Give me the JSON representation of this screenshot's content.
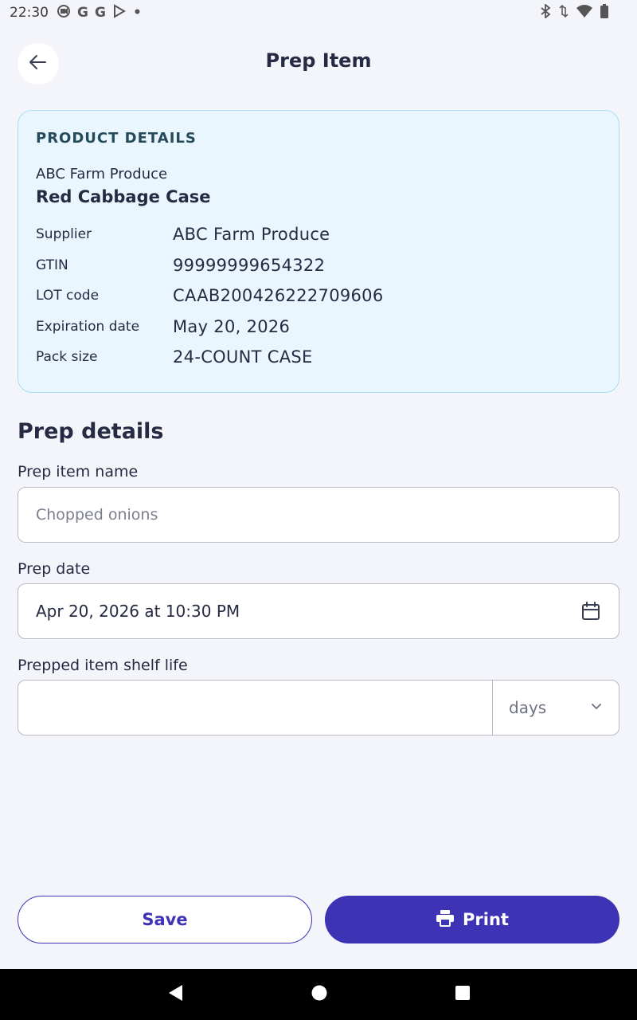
{
  "status_bar": {
    "time": "22:30",
    "left_icons": [
      "screen-record-icon",
      "google-icon",
      "google-icon",
      "play-store-icon",
      "dot-icon"
    ],
    "right_icons": [
      "bluetooth-icon",
      "data-arrows-icon",
      "wifi-icon",
      "battery-icon"
    ]
  },
  "header": {
    "title": "Prep Item",
    "back_icon": "arrow-left-icon"
  },
  "product_card": {
    "heading": "PRODUCT DETAILS",
    "supplier_top": "ABC Farm Produce",
    "product_name": "Red Cabbage Case",
    "details": [
      {
        "label": "Supplier",
        "value": "ABC Farm Produce"
      },
      {
        "label": "GTIN",
        "value": "99999999654322"
      },
      {
        "label": "LOT code",
        "value": "CAAB200426222709606"
      },
      {
        "label": "Expiration date",
        "value": "May 20, 2026"
      },
      {
        "label": "Pack size",
        "value": "24-COUNT CASE"
      }
    ]
  },
  "prep_details": {
    "title": "Prep details",
    "name_label": "Prep item name",
    "name_placeholder": "Chopped onions",
    "name_value": "",
    "date_label": "Prep date",
    "date_value": "Apr 20, 2026 at 10:30 PM",
    "shelf_label": "Prepped item shelf life",
    "shelf_value": "",
    "shelf_unit": "days"
  },
  "actions": {
    "save_label": "Save",
    "print_label": "Print"
  },
  "colors": {
    "accent": "#3e33b4",
    "card_bg": "#eaf6fe",
    "card_border": "#a9dcf2",
    "page_bg": "#f4f5fa"
  }
}
